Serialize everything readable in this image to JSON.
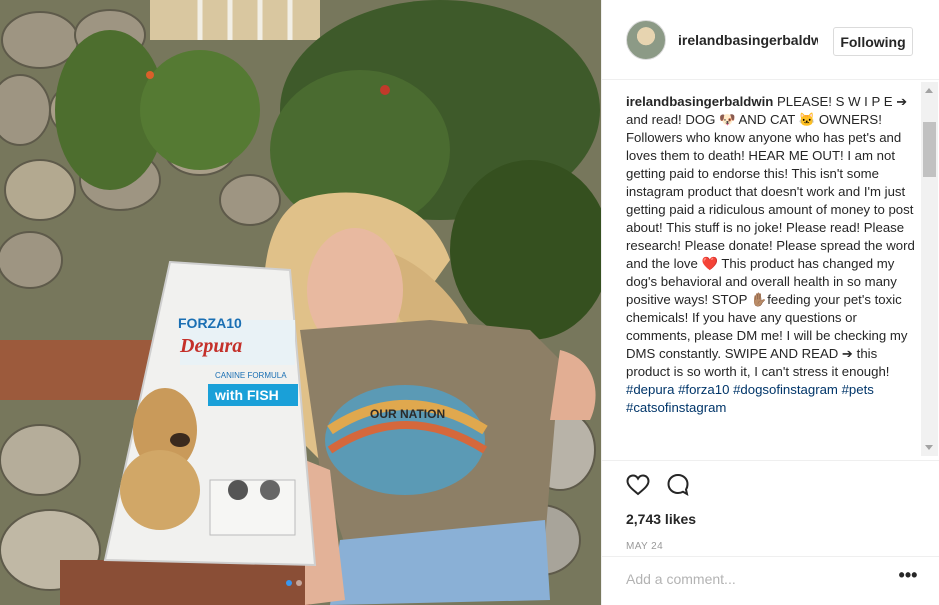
{
  "post": {
    "username": "irelandbasingerbaldwi",
    "follow_label": "Following",
    "caption_author": "irelandbasingerbaldwin",
    "caption_text": "PLEASE! S W I P E ➔ and read! DOG 🐶 AND CAT 🐱 OWNERS! Followers who know anyone who has pet's and loves them to death! HEAR ME OUT! I am not getting paid to endorse this! This isn't some instagram product that doesn't work and I'm just getting paid a ridiculous amount of money to post about! This stuff is no joke! Please read! Please research! Please donate! Please spread the word and the love ❤️ This product has changed my dog's behavioral and overall health in so many positive ways! STOP ✋🏽feeding your pet's toxic chemicals! If you have any questions or comments, please DM me! I will be checking my DMS constantly. SWIPE AND READ ➔ this product is so worth it, I can't stress it enough!",
    "hashtags": [
      "#depura",
      "#forza10",
      "#dogsofinstagram",
      "#pets",
      "#catsofinstagram"
    ],
    "likes": "2,743 likes",
    "date": "MAY 24",
    "comment_placeholder": "Add a comment...",
    "more_label": "•••"
  },
  "photo": {
    "bag_brand": "FORZA10",
    "bag_product": "Depura",
    "bag_formula": "CANINE FORMULA",
    "bag_flavor": "with FISH",
    "shirt_text": "OUR NATION"
  },
  "icons": [
    "heart-icon",
    "comment-icon",
    "more-options-icon"
  ],
  "colors": {
    "link": "#003569",
    "text": "#262626",
    "muted": "#999999",
    "border": "#efefef"
  }
}
